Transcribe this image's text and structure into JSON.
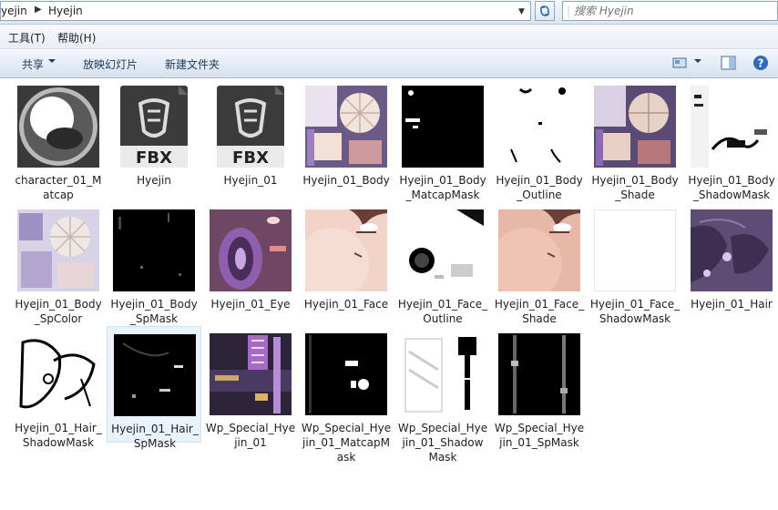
{
  "address": {
    "crumb_root": "yejin",
    "crumb_current": "Hyejin"
  },
  "search": {
    "placeholder": "搜索 Hyejin"
  },
  "menu": {
    "tools": "工具(T)",
    "help": "帮助(H)"
  },
  "toolbar": {
    "share": "共享",
    "slideshow": "放映幻灯片",
    "new_folder": "新建文件夹"
  },
  "files": [
    {
      "name": "character_01_M\natcap",
      "thumb": "matcap"
    },
    {
      "name": "Hyejin",
      "thumb": "fbx"
    },
    {
      "name": "Hyejin_01",
      "thumb": "fbx"
    },
    {
      "name": "Hyejin_01_Body",
      "thumb": "body"
    },
    {
      "name": "Hyejin_01_Body\n_MatcapMask",
      "thumb": "black-mask"
    },
    {
      "name": "Hyejin_01_Body\n_Outline",
      "thumb": "white-outline"
    },
    {
      "name": "Hyejin_01_Body\n_Shade",
      "thumb": "body-shade"
    },
    {
      "name": "Hyejin_01_Body\n_ShadowMask",
      "thumb": "shadowmask"
    },
    {
      "name": "Hyejin_01_Body\n_SpColor",
      "thumb": "spcolor"
    },
    {
      "name": "Hyejin_01_Body\n_SpMask",
      "thumb": "black-dots"
    },
    {
      "name": "Hyejin_01_Eye",
      "thumb": "eye"
    },
    {
      "name": "Hyejin_01_Face",
      "thumb": "face"
    },
    {
      "name": "Hyejin_01_Face_\nOutline",
      "thumb": "face-outline"
    },
    {
      "name": "Hyejin_01_Face_\nShade",
      "thumb": "face-shade"
    },
    {
      "name": "Hyejin_01_Face_\nShadowMask",
      "thumb": "white"
    },
    {
      "name": "Hyejin_01_Hair",
      "thumb": "hair"
    },
    {
      "name": "Hyejin_01_Hair_\nShadowMask",
      "thumb": "hair-shadow"
    },
    {
      "name": "Hyejin_01_Hair_\nSpMask",
      "thumb": "hair-spmask"
    },
    {
      "name": "Wp_Special_Hye\njin_01",
      "thumb": "wp"
    },
    {
      "name": "Wp_Special_Hye\njin_01_MatcapM\nask",
      "thumb": "wp-matcap"
    },
    {
      "name": "Wp_Special_Hye\njin_01_Shadow\nMask",
      "thumb": "wp-shadow"
    },
    {
      "name": "Wp_Special_Hye\njin_01_SpMask",
      "thumb": "wp-spmask"
    }
  ]
}
